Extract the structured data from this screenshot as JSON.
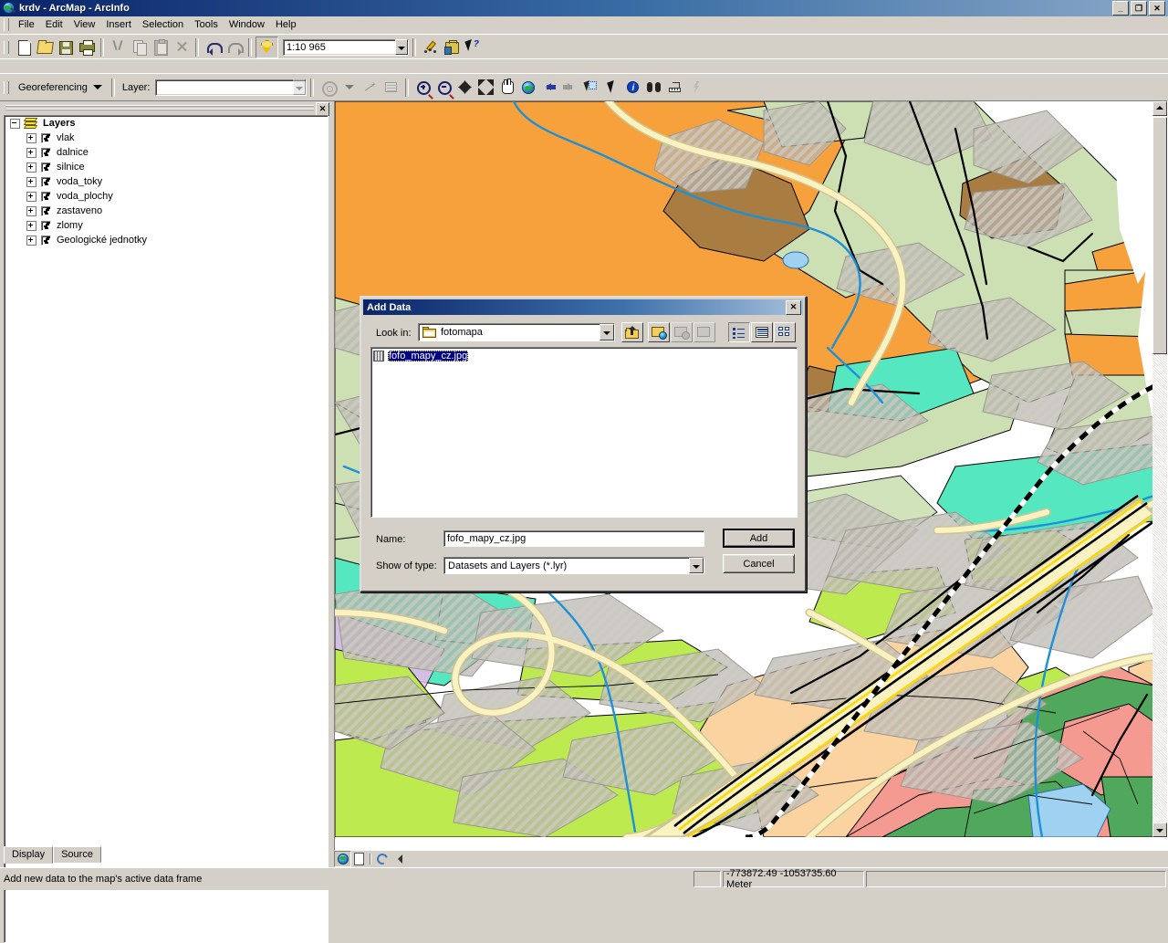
{
  "window": {
    "title": "krdv - ArcMap - ArcInfo",
    "app_icon": "arcmap-globe-icon",
    "minimize_label": "_",
    "restore_label": "❐",
    "close_label": "✕"
  },
  "menubar": {
    "items": [
      {
        "label": "File"
      },
      {
        "label": "Edit"
      },
      {
        "label": "View"
      },
      {
        "label": "Insert"
      },
      {
        "label": "Selection"
      },
      {
        "label": "Tools"
      },
      {
        "label": "Window"
      },
      {
        "label": "Help"
      }
    ]
  },
  "toolbar_standard": {
    "buttons": [
      {
        "name": "new-map-button",
        "icon": "new-document-icon",
        "disabled": false
      },
      {
        "name": "open-button",
        "icon": "open-folder-icon",
        "disabled": false
      },
      {
        "name": "save-button",
        "icon": "floppy-disk-icon",
        "disabled": false
      },
      {
        "name": "print-button",
        "icon": "printer-icon",
        "disabled": false
      },
      {
        "name": "cut-button",
        "icon": "scissors-icon",
        "disabled": true
      },
      {
        "name": "copy-button",
        "icon": "copy-icon",
        "disabled": true
      },
      {
        "name": "paste-button",
        "icon": "clipboard-icon",
        "disabled": true
      },
      {
        "name": "delete-button",
        "icon": "x-delete-icon",
        "disabled": true
      },
      {
        "name": "undo-button",
        "icon": "undo-arrow-icon",
        "disabled": false
      },
      {
        "name": "redo-button",
        "icon": "redo-arrow-icon",
        "disabled": true
      },
      {
        "name": "add-data-button",
        "icon": "add-data-plus-icon",
        "disabled": false
      }
    ],
    "scale": {
      "label": "map-scale-combo",
      "value": "1:10 965"
    },
    "right_buttons": [
      {
        "name": "editor-toolbar-button",
        "icon": "pencil-edit-icon"
      },
      {
        "name": "arctoolbox-button",
        "icon": "toolbox-icon"
      },
      {
        "name": "whats-this-button",
        "icon": "arrow-question-icon"
      }
    ]
  },
  "toolbar_georeferencing": {
    "dropdown_label": "Georeferencing",
    "layer_label": "Layer:",
    "layer_value": "",
    "layer_placeholder": "",
    "buttons": [
      {
        "name": "rotate-button",
        "icon": "rotate-icon",
        "disabled": true
      },
      {
        "name": "rotate-dropdown",
        "icon": "chevron-down-icon",
        "disabled": true
      },
      {
        "name": "add-control-points",
        "icon": "control-points-icon",
        "disabled": true
      },
      {
        "name": "view-link-table",
        "icon": "link-table-icon",
        "disabled": true
      }
    ]
  },
  "toolbar_tools": {
    "buttons": [
      {
        "name": "zoom-in-button",
        "icon": "magnifier-plus-icon"
      },
      {
        "name": "zoom-out-button",
        "icon": "magnifier-minus-icon"
      },
      {
        "name": "fixed-zoom-in-button",
        "icon": "fixed-zoom-in-icon"
      },
      {
        "name": "fixed-zoom-out-button",
        "icon": "fixed-zoom-out-icon"
      },
      {
        "name": "pan-button",
        "icon": "hand-pan-icon"
      },
      {
        "name": "full-extent-button",
        "icon": "globe-full-extent-icon"
      },
      {
        "name": "go-back-extent-button",
        "icon": "arrow-left-icon"
      },
      {
        "name": "go-next-extent-button",
        "icon": "arrow-right-icon"
      },
      {
        "name": "select-features-button",
        "icon": "select-features-icon"
      },
      {
        "name": "select-elements-button",
        "icon": "pointer-arrow-icon"
      },
      {
        "name": "identify-button",
        "icon": "info-circle-icon"
      },
      {
        "name": "find-button",
        "icon": "binoculars-icon"
      },
      {
        "name": "measure-button",
        "icon": "measure-ruler-icon"
      },
      {
        "name": "hyperlink-button",
        "icon": "lightning-bolt-icon"
      }
    ]
  },
  "toc": {
    "close_label": "✕",
    "root": {
      "label": "Layers",
      "icon": "layers-stack-icon",
      "expanded": true,
      "checked": true
    },
    "layers": [
      {
        "label": "vlak",
        "checked": true,
        "expanded": false
      },
      {
        "label": "dalnice",
        "checked": true,
        "expanded": false
      },
      {
        "label": "silnice",
        "checked": true,
        "expanded": false
      },
      {
        "label": "voda_toky",
        "checked": true,
        "expanded": false
      },
      {
        "label": "voda_plochy",
        "checked": true,
        "expanded": false
      },
      {
        "label": "zastaveno",
        "checked": true,
        "expanded": false
      },
      {
        "label": "zlomy",
        "checked": true,
        "expanded": false
      },
      {
        "label": "Geologické jednotky",
        "checked": true,
        "expanded": false
      }
    ],
    "tabs": [
      {
        "label": "Display",
        "active": true
      },
      {
        "label": "Source",
        "active": false
      }
    ]
  },
  "view_toolbar": {
    "buttons": [
      {
        "name": "data-view-button",
        "icon": "globe-data-view-icon",
        "selected": true
      },
      {
        "name": "layout-view-button",
        "icon": "page-layout-view-icon",
        "selected": false
      },
      {
        "name": "refresh-view-button",
        "icon": "refresh-icon",
        "selected": false
      },
      {
        "name": "pause-drawing-button",
        "icon": "pause-drawing-icon",
        "selected": false
      }
    ]
  },
  "statusbar": {
    "message": "Add new data to the map's active data frame",
    "coordinates": "-773872.49  -1053735.60 Meter"
  },
  "add_data_dialog": {
    "title": "Add Data",
    "close_label": "✕",
    "look_in_label": "Look in:",
    "look_in_value": "fotomapa",
    "look_in_icon": "folder-icon",
    "toolbuttons": [
      {
        "name": "up-one-level-button",
        "icon": "up-one-level-icon",
        "disabled": false
      },
      {
        "name": "connect-to-folder-button",
        "icon": "connect-folder-icon",
        "disabled": false
      },
      {
        "name": "disconnect-folder-button",
        "icon": "disconnect-folder-icon",
        "disabled": true
      },
      {
        "name": "new-folder-button",
        "icon": "new-folder-icon",
        "disabled": true
      },
      {
        "name": "list-view-button",
        "icon": "list-view-icon",
        "disabled": false
      },
      {
        "name": "details-view-button",
        "icon": "details-view-icon",
        "disabled": false
      },
      {
        "name": "thumbnails-view-button",
        "icon": "thumbnails-view-icon",
        "disabled": false
      }
    ],
    "files": [
      {
        "name": "fofo_mapy_cz.jpg",
        "icon": "raster-dataset-icon",
        "selected": true
      }
    ],
    "name_label": "Name:",
    "name_value": "fofo_mapy_cz.jpg",
    "type_label": "Show of type:",
    "type_value": "Datasets and Layers (*.lyr)",
    "add_button": "Add",
    "cancel_button": "Cancel"
  },
  "colors": {
    "titlebar_active": "#0a246a",
    "window_face": "#d4d0c8",
    "selection": "#000080",
    "map_orange": "#f7a13c",
    "map_pale_green": "#cde0b4",
    "map_brown": "#a97c41",
    "map_cyan": "#55e8c0",
    "map_lime": "#bdeb4f",
    "map_peach": "#fbd3a0",
    "map_salmon": "#f59a90",
    "map_green": "#4fa85c",
    "map_blue_water": "#9ed2f0",
    "map_stream": "#1e90d8",
    "map_road": "#f5efbb"
  }
}
